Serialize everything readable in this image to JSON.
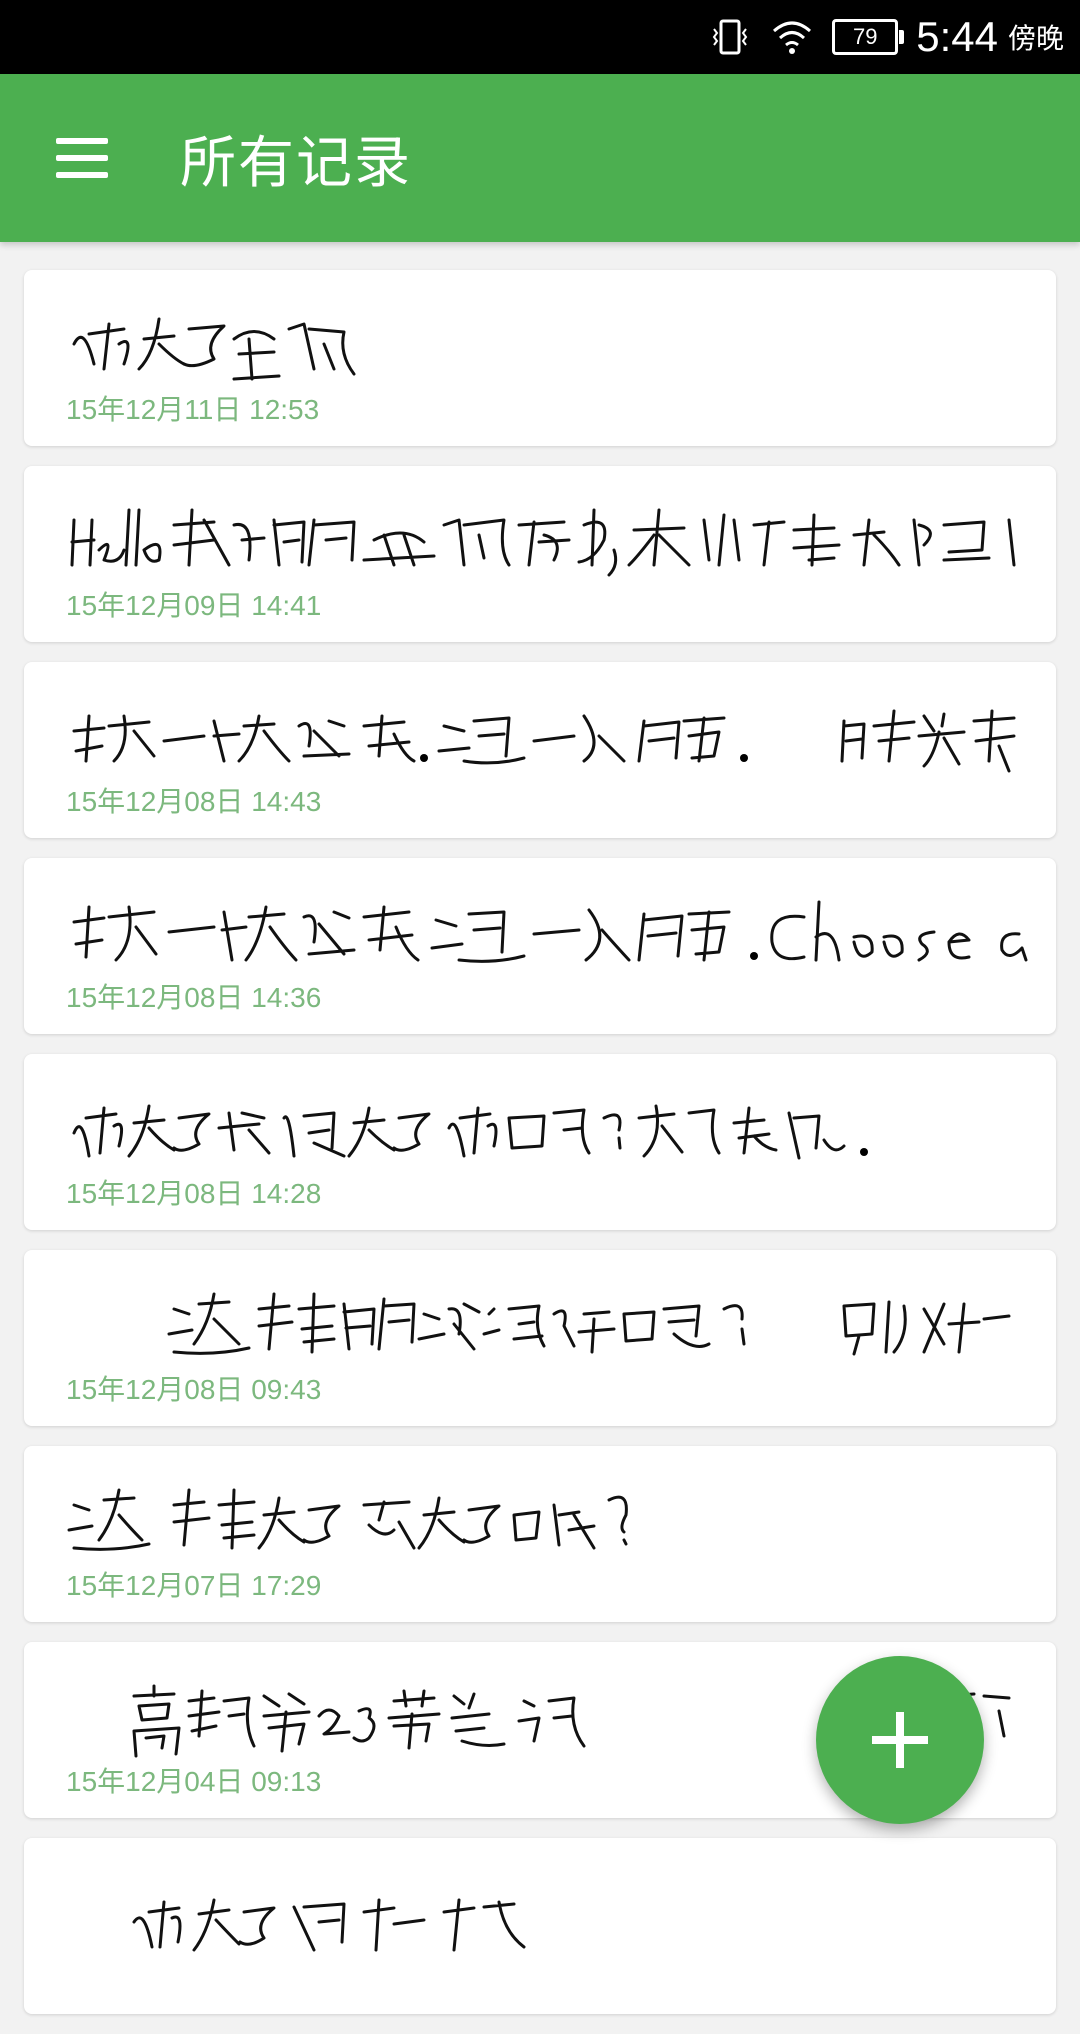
{
  "status_bar": {
    "battery": "79",
    "time": "5:44",
    "period": "傍晚"
  },
  "app_bar": {
    "title": "所有记录",
    "menu_icon": "hamburger-menu-icon"
  },
  "colors": {
    "primary": "#4caf50",
    "date_text": "#7cb87e",
    "background": "#f2f2f2"
  },
  "notes": [
    {
      "date": "15年12月11日 12:53"
    },
    {
      "date": "15年12月09日 14:41"
    },
    {
      "date": "15年12月08日 14:43"
    },
    {
      "date": "15年12月08日 14:36"
    },
    {
      "date": "15年12月08日 14:28"
    },
    {
      "date": "15年12月08日 09:43"
    },
    {
      "date": "15年12月07日 17:29"
    },
    {
      "date": "15年12月04日 09:13"
    }
  ],
  "fab": {
    "icon": "plus-icon"
  }
}
